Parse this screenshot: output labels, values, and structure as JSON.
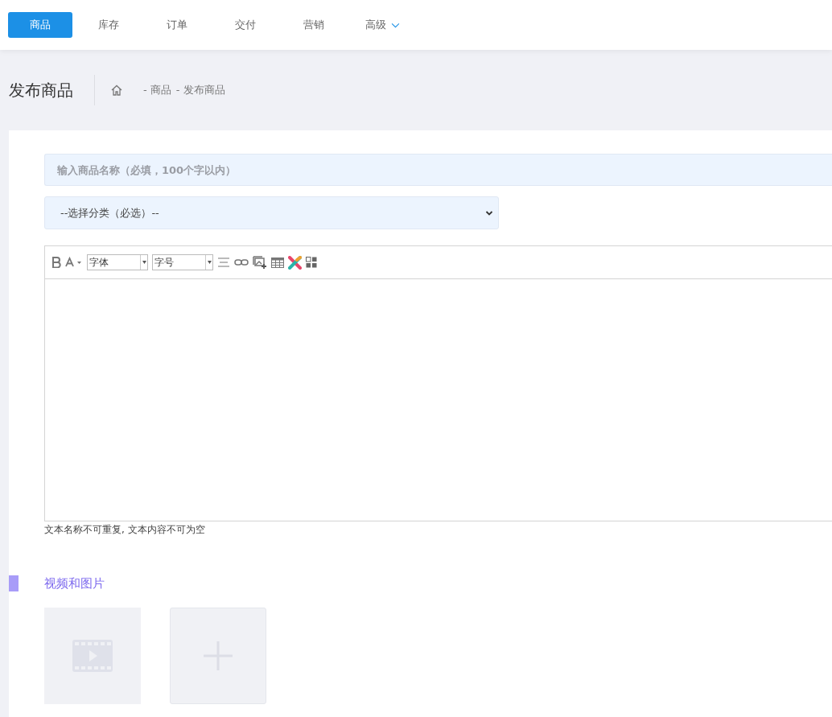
{
  "nav": {
    "tabs": [
      {
        "label": "商品",
        "selected": true,
        "has_menu": false
      },
      {
        "label": "库存",
        "selected": false,
        "has_menu": false
      },
      {
        "label": "订单",
        "selected": false,
        "has_menu": false
      },
      {
        "label": "交付",
        "selected": false,
        "has_menu": false
      },
      {
        "label": "营销",
        "selected": false,
        "has_menu": false
      },
      {
        "label": "高级",
        "selected": false,
        "has_menu": true
      }
    ]
  },
  "header": {
    "title": "发布商品",
    "breadcrumb": [
      "- 商品",
      "- 发布商品"
    ]
  },
  "form": {
    "name_field": {
      "placeholder": "输入商品名称（必填，100个字以内）"
    },
    "category_select": {
      "value": "--选择分类（必选）--"
    },
    "editor": {
      "selects": [
        {
          "value": "字体"
        },
        {
          "value": "字号"
        }
      ]
    },
    "hint": "文本名称不可重复, 文本内容不可为空"
  },
  "media": {
    "title": "视频和图片"
  }
}
